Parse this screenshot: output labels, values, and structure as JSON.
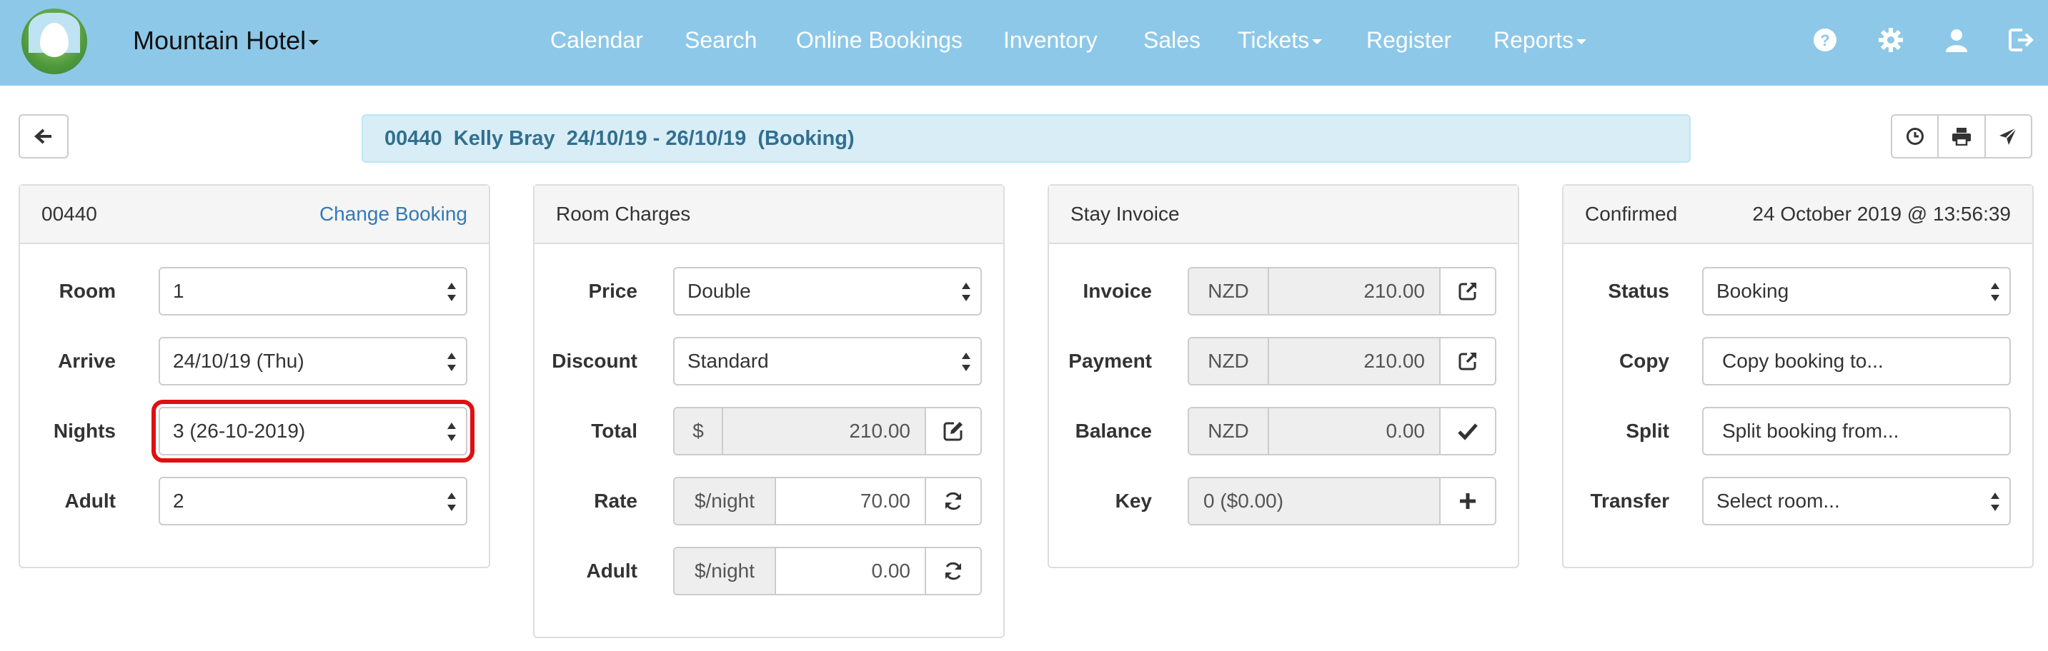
{
  "navbar": {
    "brand": "Mountain Hotel",
    "items": [
      "Calendar",
      "Search",
      "Online Bookings",
      "Inventory",
      "Sales",
      "Tickets",
      "Register",
      "Reports"
    ],
    "icons": [
      "help-icon",
      "gear-icon",
      "user-icon",
      "logout-icon"
    ],
    "colors": {
      "background": "#8dc8e8",
      "text": "#ffffff"
    }
  },
  "banner": {
    "text": "00440  Kelly Bray  24/10/19 - 26/10/19  (Booking)"
  },
  "toolbar_icons": [
    "back-arrow-icon",
    "clock-icon",
    "print-icon",
    "send-icon"
  ],
  "booking_panel": {
    "number": "00440",
    "change_link": "Change Booking",
    "room_label": "Room",
    "room_value": "1",
    "arrive_label": "Arrive",
    "arrive_value": "24/10/19  (Thu)",
    "nights_label": "Nights",
    "nights_value": "3  (26-10-2019)",
    "adult_label": "Adult",
    "adult_value": "2"
  },
  "charges_panel": {
    "title": "Room Charges",
    "price_label": "Price",
    "price_value": "Double",
    "discount_label": "Discount",
    "discount_value": "Standard",
    "total_label": "Total",
    "total_currency": "$",
    "total_value": "210.00",
    "rate_label": "Rate",
    "rate_unit": "$/night",
    "rate_value": "70.00",
    "adult_label": "Adult",
    "adult_unit": "$/night",
    "adult_value": "0.00"
  },
  "invoice_panel": {
    "title": "Stay Invoice",
    "invoice_label": "Invoice",
    "invoice_currency": "NZD",
    "invoice_value": "210.00",
    "payment_label": "Payment",
    "payment_currency": "NZD",
    "payment_value": "210.00",
    "balance_label": "Balance",
    "balance_currency": "NZD",
    "balance_value": "0.00",
    "key_label": "Key",
    "key_value": "0 ($0.00)"
  },
  "status_panel": {
    "state": "Confirmed",
    "timestamp": "24 October 2019 @ 13:56:39",
    "status_label": "Status",
    "status_value": "Booking",
    "copy_label": "Copy",
    "copy_value": "Copy booking to...",
    "split_label": "Split",
    "split_value": "Split booking from...",
    "transfer_label": "Transfer",
    "transfer_placeholder": "Select room..."
  },
  "colors": {
    "highlight": "#e01010",
    "link": "#337ab7",
    "banner_text": "#31708f",
    "banner_bg": "#d9edf7"
  }
}
